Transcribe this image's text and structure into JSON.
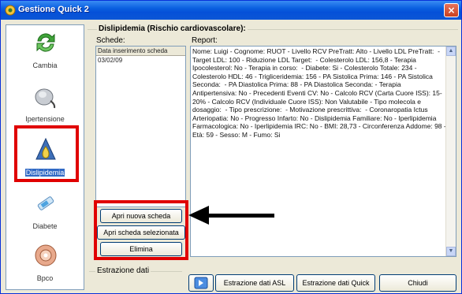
{
  "window": {
    "title": "Gestione Quick 2",
    "close_symbol": "×"
  },
  "sidebar": {
    "items": [
      {
        "label": "Cambia",
        "icon": "refresh-arrows-icon"
      },
      {
        "label": "Ipertensione",
        "icon": "blood-pressure-icon"
      },
      {
        "label": "Dislipidemia",
        "icon": "drop-icon"
      },
      {
        "label": "Diabete",
        "icon": "syringe-icon"
      },
      {
        "label": "Bpco",
        "icon": "lungs-icon"
      }
    ],
    "active": "Dislipidemia"
  },
  "panel": {
    "title": "Dislipidemia (Rischio cardiovascolare):",
    "schede_label": "Schede:",
    "report_label": "Report:"
  },
  "list": {
    "header": "Data inserimento scheda",
    "rows": [
      "03/02/09"
    ]
  },
  "report": {
    "text": "Nome: Luigi - Cognome: RUOT - Livello RCV PreTratt: Alto - Livello LDL PreTratt:  - Target LDL: 100 - Riduzione LDL Target:  - Colesterolo LDL: 156,8 - Terapia Ipocolesterol: No - Terapia in corso:  - Diabete: Si - Colesterolo Totale: 234 - Colesterolo HDL: 46 - Trigliceridemia: 156 - PA Sistolica Prima: 146 - PA Sistolica Seconda:  - PA Diastolica Prima: 88 - PA Diastolica Seconda: - Terapia Antipertensiva: No - Precedenti Eventi CV: No - Calcolo RCV (Carta Cuore ISS): 15-20% - Calcolo RCV (Individuale Cuore ISS): Non Valutabile - Tipo molecola e dosaggio:  - Tipo prescrizione:  - Motivazione prescrittiva:  - Coronaropatia Ictus Arteriopatia: No - Progresso Infarto: No - Dislipidemia Familiare: No - Iperlipidemia Farmacologica: No - Iperlipidemia IRC: No - BMI: 28,73 - Circonferenza Addome: 98 - Età: 59 - Sesso: M - Fumo: Si"
  },
  "buttons": {
    "nuova": "Apri nuova scheda",
    "selezionata": "Apri scheda selezionata",
    "elimina": "Elimina"
  },
  "estrazione": {
    "title": "Estrazione dati",
    "asl": "Estrazione dati ASL",
    "quick": "Estrazione dati Quick",
    "chiudi": "Chiudi"
  },
  "colors": {
    "highlight_red": "#e00000",
    "titlebar_blue": "#0a5fe0",
    "selection_blue": "#316ac5"
  }
}
